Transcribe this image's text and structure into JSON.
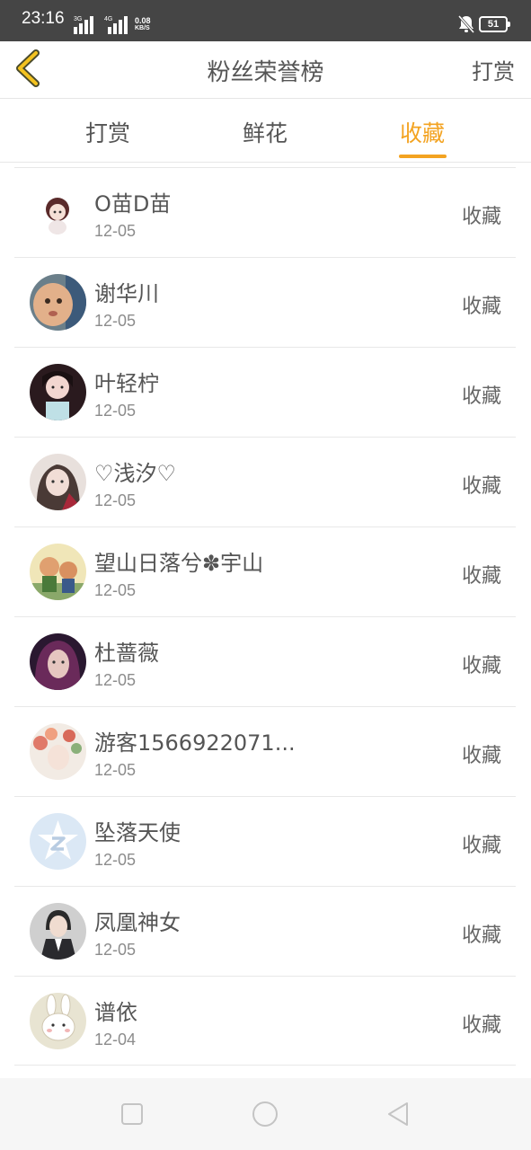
{
  "status_bar": {
    "time": "23:16",
    "net1": "3G",
    "net2": "4G",
    "speed_value": "0.08",
    "speed_unit": "KB/S",
    "battery": "51"
  },
  "header": {
    "title": "粉丝荣誉榜",
    "action": "打赏"
  },
  "tabs": [
    {
      "label": "打赏",
      "active": false
    },
    {
      "label": "鲜花",
      "active": false
    },
    {
      "label": "收藏",
      "active": true
    }
  ],
  "fans": [
    {
      "name": "O苗D苗",
      "date": "12-05",
      "action": "收藏",
      "avatar": "avatar-doll"
    },
    {
      "name": "谢华川",
      "date": "12-05",
      "action": "收藏",
      "avatar": "avatar-baby"
    },
    {
      "name": "叶轻柠",
      "date": "12-05",
      "action": "收藏",
      "avatar": "avatar-girl-dark"
    },
    {
      "name": "♡浅汐♡",
      "date": "12-05",
      "action": "收藏",
      "avatar": "avatar-painted-girl"
    },
    {
      "name": "望山日落兮✽宇山",
      "date": "12-05",
      "action": "收藏",
      "avatar": "avatar-cartoon-kids"
    },
    {
      "name": "杜蔷薇",
      "date": "12-05",
      "action": "收藏",
      "avatar": "avatar-purple-hair"
    },
    {
      "name": "游客1566922071...",
      "date": "12-05",
      "action": "收藏",
      "avatar": "avatar-flower-girl"
    },
    {
      "name": "坠落天使",
      "date": "12-05",
      "action": "收藏",
      "avatar": "avatar-qq-default"
    },
    {
      "name": "凤凰神女",
      "date": "12-05",
      "action": "收藏",
      "avatar": "avatar-suit-person"
    },
    {
      "name": "谱依",
      "date": "12-04",
      "action": "收藏",
      "avatar": "avatar-bunny"
    }
  ],
  "colors": {
    "accent": "#f3a321",
    "status_bar": "#454545",
    "text": "#555555"
  }
}
